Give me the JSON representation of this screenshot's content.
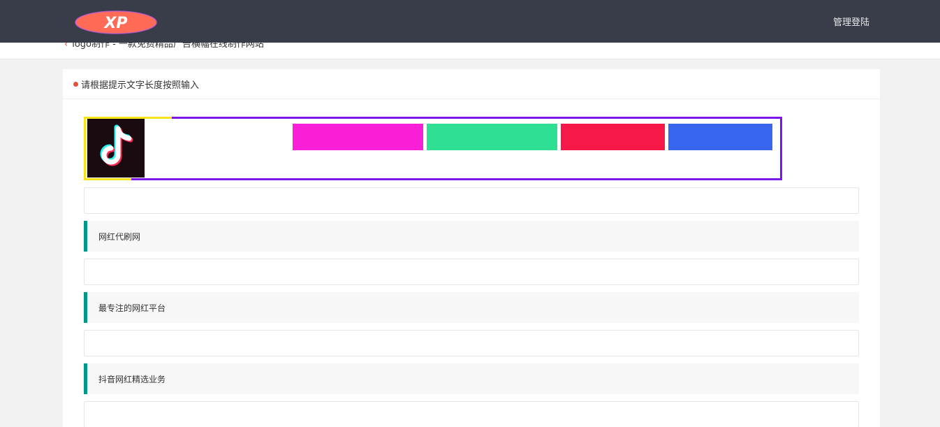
{
  "header": {
    "logo_text": "XP",
    "admin_login": "管理登陆"
  },
  "breadcrumb": {
    "text": "logo制作 - 一款免费精品广告横幅在线制作网站"
  },
  "card": {
    "title": "请根据提示文字长度按照输入"
  },
  "preview": {
    "border_color": "#7b17e8",
    "corner_color": "#f5e31b",
    "icon": "tiktok-logo-icon",
    "blocks": [
      "#f81fd6",
      "#2fdf93",
      "#f61847",
      "#3866ee"
    ]
  },
  "form": {
    "inputs": [
      "",
      "",
      "",
      ""
    ],
    "labels": [
      "网红代刷网",
      "最专注的网红平台",
      "抖音网红精选业务"
    ]
  },
  "colors": {
    "topbar": "#393d49",
    "accent": "#009688",
    "dot": "#e2523a"
  }
}
